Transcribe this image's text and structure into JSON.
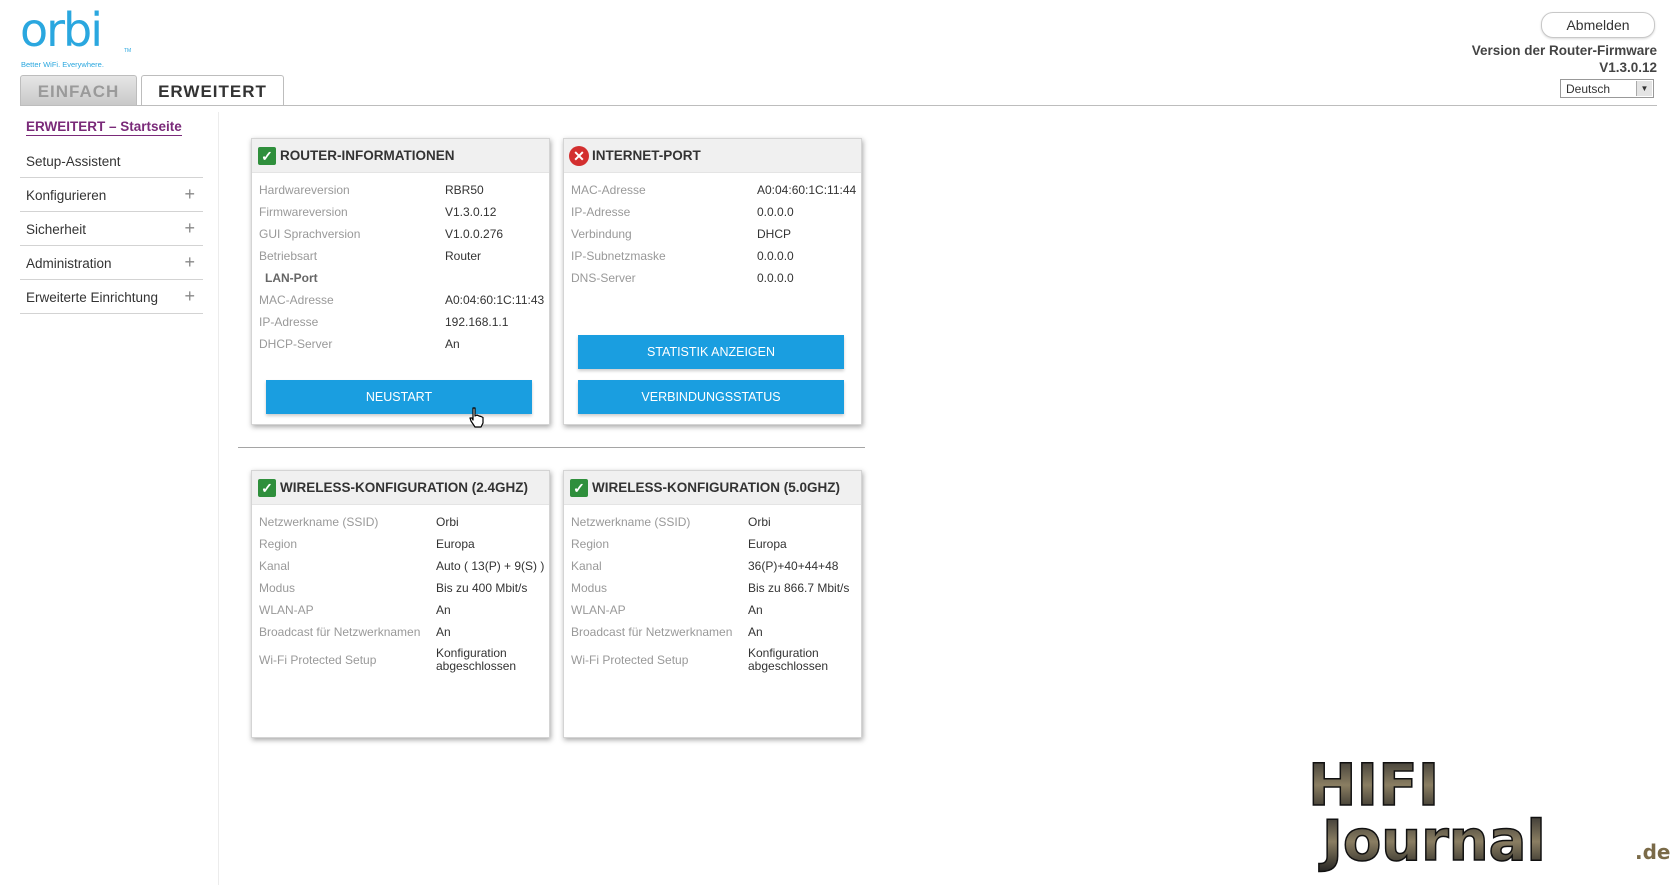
{
  "logo": {
    "name": "orbi",
    "tagline": "Better WiFi. Everywhere.",
    "tm": "TM"
  },
  "tabs": [
    {
      "label": "EINFACH"
    },
    {
      "label": "ERWEITERT"
    }
  ],
  "header": {
    "logout_label": "Abmelden",
    "firmware_label": "Version der Router-Firmware",
    "firmware_version": "V1.3.0.12",
    "language": "Deutsch"
  },
  "sidebar": {
    "active": "ERWEITERT – Startseite",
    "items": [
      {
        "label": "Setup-Assistent",
        "expandable": false
      },
      {
        "label": "Konfigurieren",
        "expandable": true
      },
      {
        "label": "Sicherheit",
        "expandable": true
      },
      {
        "label": "Administration",
        "expandable": true
      },
      {
        "label": "Erweiterte Einrichtung",
        "expandable": true
      }
    ],
    "plus_glyph": "+"
  },
  "router_info": {
    "title": "ROUTER-INFORMATIONEN",
    "status": "ok",
    "rows": [
      {
        "label": "Hardwareversion",
        "value": "RBR50"
      },
      {
        "label": "Firmwareversion",
        "value": "V1.3.0.12"
      },
      {
        "label": "GUI Sprachversion",
        "value": "V1.0.0.276"
      },
      {
        "label": "Betriebsart",
        "value": "Router"
      }
    ],
    "lan_port_label": "LAN-Port",
    "lan_rows": [
      {
        "label": "MAC-Adresse",
        "value": "A0:04:60:1C:11:43"
      },
      {
        "label": "IP-Adresse",
        "value": "192.168.1.1"
      },
      {
        "label": "DHCP-Server",
        "value": "An"
      }
    ],
    "button_label": "NEUSTART"
  },
  "internet_port": {
    "title": "INTERNET-PORT",
    "status": "error",
    "rows": [
      {
        "label": "MAC-Adresse",
        "value": "A0:04:60:1C:11:44"
      },
      {
        "label": "IP-Adresse",
        "value": "0.0.0.0"
      },
      {
        "label": "Verbindung",
        "value": "DHCP"
      },
      {
        "label": "IP-Subnetzmaske",
        "value": "0.0.0.0"
      },
      {
        "label": "DNS-Server",
        "value": "0.0.0.0"
      }
    ],
    "button_stats": "STATISTIK ANZEIGEN",
    "button_status": "VERBINDUNGSSTATUS"
  },
  "wireless_24": {
    "title": "WIRELESS-KONFIGURATION (2.4GHZ)",
    "status": "ok",
    "rows": [
      {
        "label": "Netzwerkname (SSID)",
        "value": "Orbi"
      },
      {
        "label": "Region",
        "value": "Europa"
      },
      {
        "label": "Kanal",
        "value": "Auto ( 13(P) + 9(S) )"
      },
      {
        "label": "Modus",
        "value": "Bis zu 400 Mbit/s"
      },
      {
        "label": "WLAN-AP",
        "value": "An"
      },
      {
        "label": "Broadcast für Netzwerknamen",
        "value": "An"
      },
      {
        "label": "Wi-Fi Protected Setup",
        "value": "Konfiguration abgeschlossen"
      }
    ]
  },
  "wireless_50": {
    "title": "WIRELESS-KONFIGURATION (5.0GHZ)",
    "status": "ok",
    "rows": [
      {
        "label": "Netzwerkname (SSID)",
        "value": "Orbi"
      },
      {
        "label": "Region",
        "value": "Europa"
      },
      {
        "label": "Kanal",
        "value": "36(P)+40+44+48"
      },
      {
        "label": "Modus",
        "value": "Bis zu 866.7 Mbit/s"
      },
      {
        "label": "WLAN-AP",
        "value": "An"
      },
      {
        "label": "Broadcast für Netzwerknamen",
        "value": "An"
      },
      {
        "label": "Wi-Fi Protected Setup",
        "value": "Konfiguration abgeschlossen"
      }
    ]
  },
  "watermark": {
    "line1": "HIFI",
    "line2": "Journal",
    "suffix": ".de"
  },
  "icons": {
    "ok": "check-icon",
    "error": "error-x-icon",
    "cursor": "hand-cursor-icon",
    "dropdown": "dropdown-arrow-icon"
  },
  "colors": {
    "accent_blue": "#1a9ee0",
    "logo_blue": "#2aa7df",
    "active_purple": "#7a2a79",
    "ok_green": "#2f8f3c",
    "error_red": "#d32f2f"
  }
}
